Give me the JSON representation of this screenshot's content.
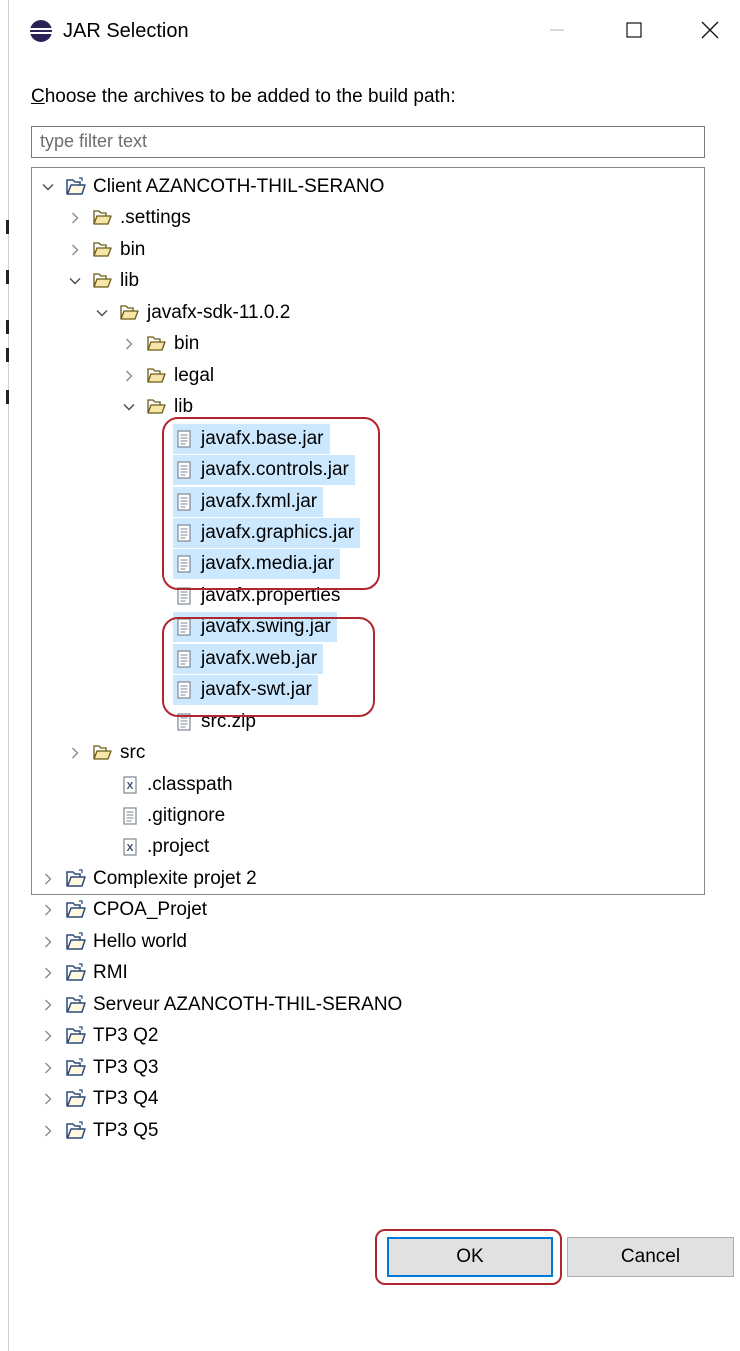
{
  "window": {
    "title": "JAR Selection",
    "minimize_glyph": "—",
    "maximize_glyph": "☐",
    "close_glyph": "✕"
  },
  "instruction": {
    "mnemonic": "C",
    "rest": "hoose the archives to be added to the build path:"
  },
  "filter": {
    "placeholder": "type filter text"
  },
  "tree": {
    "rows": [
      {
        "label": "Client AZANCOTH-THIL-SERANO",
        "depth": 0,
        "type": "project",
        "expanded": true
      },
      {
        "label": ".settings",
        "depth": 1,
        "type": "folder",
        "expanded": false
      },
      {
        "label": "bin",
        "depth": 1,
        "type": "folder",
        "expanded": false
      },
      {
        "label": "lib",
        "depth": 1,
        "type": "folder",
        "expanded": true
      },
      {
        "label": "javafx-sdk-11.0.2",
        "depth": 2,
        "type": "folder",
        "expanded": true
      },
      {
        "label": "bin",
        "depth": 3,
        "type": "folder",
        "expanded": false
      },
      {
        "label": "legal",
        "depth": 3,
        "type": "folder",
        "expanded": false
      },
      {
        "label": "lib",
        "depth": 3,
        "type": "folder",
        "expanded": true
      },
      {
        "label": "javafx.base.jar",
        "depth": 4,
        "type": "file",
        "selected": true
      },
      {
        "label": "javafx.controls.jar",
        "depth": 4,
        "type": "file",
        "selected": true
      },
      {
        "label": "javafx.fxml.jar",
        "depth": 4,
        "type": "file",
        "selected": true
      },
      {
        "label": "javafx.graphics.jar",
        "depth": 4,
        "type": "file",
        "selected": true
      },
      {
        "label": "javafx.media.jar",
        "depth": 4,
        "type": "file",
        "selected": true
      },
      {
        "label": "javafx.properties",
        "depth": 4,
        "type": "file",
        "selected": false
      },
      {
        "label": "javafx.swing.jar",
        "depth": 4,
        "type": "file",
        "selected": true
      },
      {
        "label": "javafx.web.jar",
        "depth": 4,
        "type": "file",
        "selected": true
      },
      {
        "label": "javafx-swt.jar",
        "depth": 4,
        "type": "file",
        "selected": true
      },
      {
        "label": "src.zip",
        "depth": 4,
        "type": "file",
        "selected": false
      },
      {
        "label": "src",
        "depth": 1,
        "type": "folder",
        "expanded": false
      },
      {
        "label": ".classpath",
        "depth": 2,
        "type": "xml"
      },
      {
        "label": ".gitignore",
        "depth": 2,
        "type": "file"
      },
      {
        "label": ".project",
        "depth": 2,
        "type": "xml"
      },
      {
        "label": "Complexite projet 2",
        "depth": 0,
        "type": "project",
        "expanded": false
      },
      {
        "label": "CPOA_Projet",
        "depth": 0,
        "type": "project",
        "expanded": false
      },
      {
        "label": "Hello world",
        "depth": 0,
        "type": "project",
        "expanded": false
      },
      {
        "label": "RMI",
        "depth": 0,
        "type": "project",
        "expanded": false
      },
      {
        "label": "Serveur AZANCOTH-THIL-SERANO",
        "depth": 0,
        "type": "project",
        "expanded": false
      },
      {
        "label": "TP3 Q2",
        "depth": 0,
        "type": "project",
        "expanded": false
      },
      {
        "label": "TP3 Q3",
        "depth": 0,
        "type": "project",
        "expanded": false
      },
      {
        "label": "TP3 Q4",
        "depth": 0,
        "type": "project",
        "expanded": false
      },
      {
        "label": "TP3 Q5",
        "depth": 0,
        "type": "project",
        "expanded": false
      }
    ]
  },
  "buttons": {
    "ok": "OK",
    "cancel": "Cancel"
  },
  "colors": {
    "selection": "#cce8ff",
    "highlight": "#b0262e",
    "default_button_border": "#0078d7"
  }
}
